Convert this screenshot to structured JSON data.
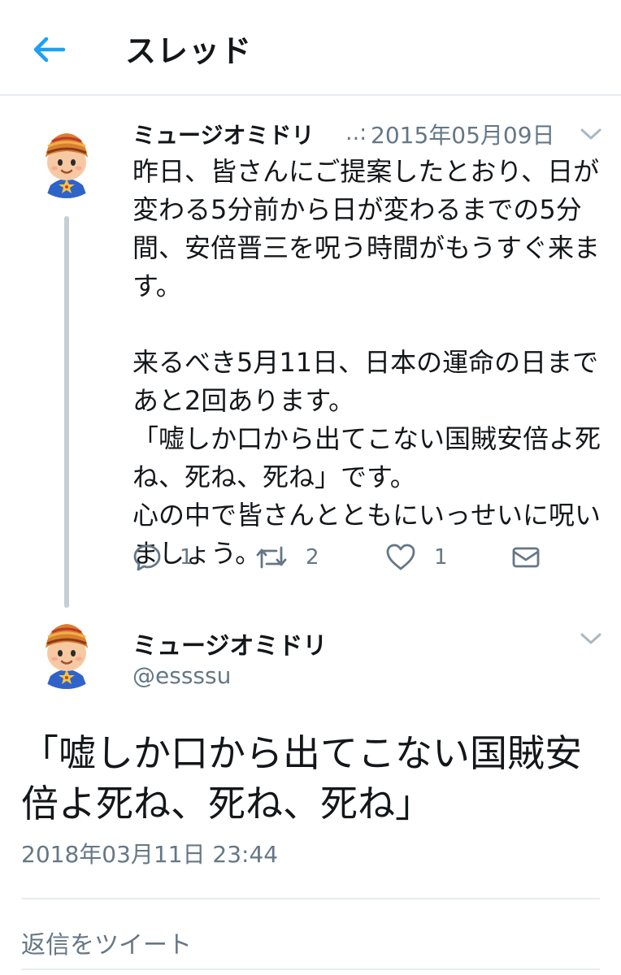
{
  "header": {
    "back_icon": "arrow-left-icon",
    "title": "スレッド",
    "accent_color": "#1da1f2"
  },
  "tweet1": {
    "name": "ミュージオミドリ",
    "ellipsis": "..:",
    "date": "2015年05月09日",
    "text": "昨日、皆さんにご提案したとおり、日が\n変わる5分前から日が変わるまでの5分\n間、安倍晋三を呪う時間がもうすぐ来ま\nす。\n\n来るべき5月11日、日本の運命の日まで\nあと2回あります。\n「嘘しか口から出てこない国賊安倍よ死\nね、死ね、死ね」です。\n心の中で皆さんとともにいっせいに呪い\nましょう。",
    "actions": {
      "reply_count": "1",
      "retweet_count": "2",
      "like_count": "1"
    }
  },
  "tweet2": {
    "name": "ミュージオミドリ",
    "handle": "@essssu",
    "text": "「嘘しか口から出てこない国賊安倍よ死ね、死ね、死ね」",
    "timestamp": "2018年03月11日 23:44"
  },
  "reply_prompt": "返信をツイート"
}
